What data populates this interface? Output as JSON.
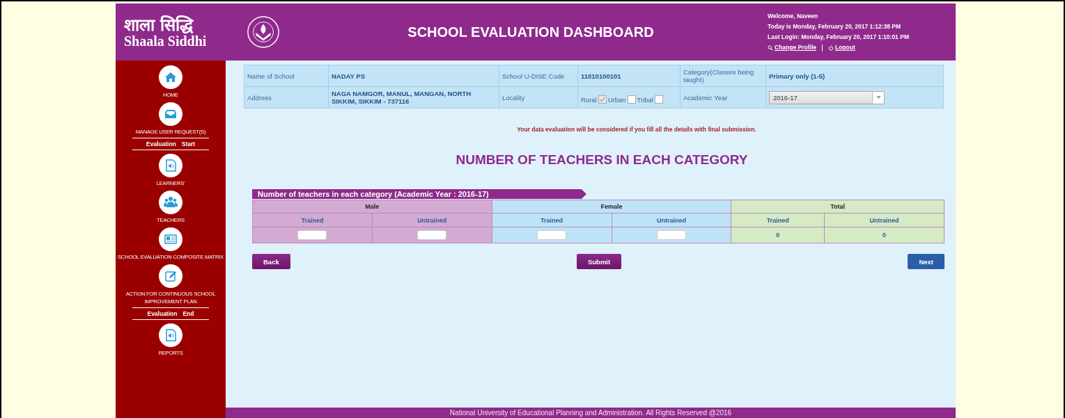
{
  "header": {
    "logo_hindi": "शाला सिद्धि",
    "logo_english": "Shaala Siddhi",
    "title": "SCHOOL EVALUATION DASHBOARD",
    "welcome": "Welcome, Naveen",
    "today": "Today is Monday, February 20, 2017 1:12:38 PM",
    "last_login": "Last Login: Monday, February 20, 2017 1:10:01 PM",
    "links": [
      "Change Profile",
      "Logout"
    ]
  },
  "sidebar": {
    "items": [
      {
        "kind": "nav",
        "label": "HOME"
      },
      {
        "kind": "nav",
        "label": "MANAGE USER REQUEST(S)"
      },
      {
        "kind": "marker",
        "words": [
          "Evaluation",
          "Start"
        ]
      },
      {
        "kind": "nav",
        "label": "LEARNERS'"
      },
      {
        "kind": "nav",
        "label": "TEACHERS"
      },
      {
        "kind": "nav",
        "label": "SCHOOL EVALUATION COMPOSITE MATRIX"
      },
      {
        "kind": "nav",
        "label": "ACTION FOR CONTINUOUS SCHOOL IMPROVEMENT PLAN"
      },
      {
        "kind": "marker",
        "words": [
          "Evaluation",
          "End"
        ]
      },
      {
        "kind": "nav",
        "label": "REPORTS"
      }
    ]
  },
  "school_info": {
    "rows": [
      [
        {
          "kind": "label",
          "text": "Name of School"
        },
        {
          "kind": "value",
          "text": "NADAY PS"
        },
        {
          "kind": "label",
          "text": "School U-DISE Code"
        },
        {
          "kind": "value",
          "text": "11010100101"
        },
        {
          "kind": "label",
          "text": "Category(Classes being taught)"
        },
        {
          "kind": "value",
          "text": "Primary only (1-5)"
        }
      ],
      [
        {
          "kind": "label",
          "text": "Address"
        },
        {
          "kind": "value",
          "text": "NAGA NAMGOR, MANUL, MANGAN, NORTH SIKKIM, SIKKIM - 737116"
        },
        {
          "kind": "label",
          "text": "Locality"
        },
        {
          "kind": "checkboxes",
          "options": [
            {
              "label": "Rural",
              "checked": true
            },
            {
              "label": "Urban",
              "checked": false
            },
            {
              "label": "Tribal",
              "checked": false
            }
          ]
        },
        {
          "kind": "label",
          "text": "Academic Year"
        },
        {
          "kind": "select",
          "text": "2016-17"
        }
      ]
    ]
  },
  "notice": "Your data evaluation will be considered if you fill all the details with final submission.",
  "heading": "NUMBER OF TEACHERS IN EACH CATEGORY",
  "teachers_table": {
    "title": "Number of teachers in each category (Academic Year : 2016-17)",
    "groups": [
      {
        "label": "Male",
        "color": "#d3aad2",
        "columns": [
          {
            "label": "Trained",
            "kind": "input"
          },
          {
            "label": "Untrained",
            "kind": "input"
          }
        ]
      },
      {
        "label": "Female",
        "color": "#bfe3f6",
        "columns": [
          {
            "label": "Trained",
            "kind": "input"
          },
          {
            "label": "Untrained",
            "kind": "input"
          }
        ]
      },
      {
        "label": "Total",
        "color": "#d6eac4",
        "columns": [
          {
            "label": "Trained",
            "kind": "value",
            "value": "0"
          },
          {
            "label": "Untrained",
            "kind": "value",
            "value": "0"
          }
        ]
      }
    ]
  },
  "buttons": [
    {
      "label": "Back",
      "kind": "purple"
    },
    {
      "label": "Submit",
      "kind": "purple"
    },
    {
      "label": "Next",
      "kind": "blue"
    }
  ],
  "footer": "National University of Educational Planning and Administration. All Rights Reserved @2016"
}
